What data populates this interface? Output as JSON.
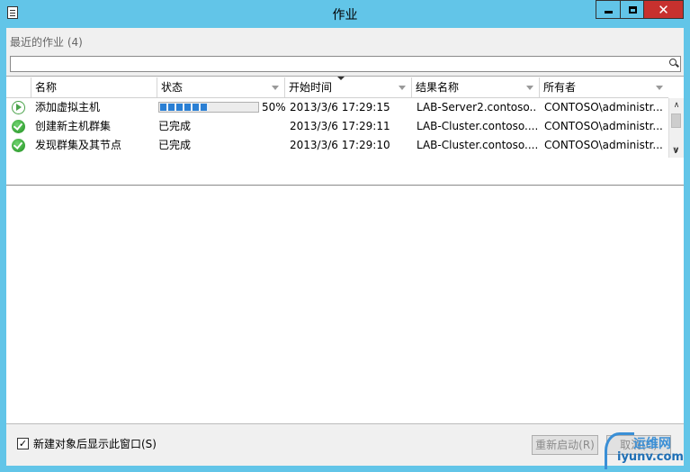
{
  "window": {
    "title": "作业",
    "close_glyph": "✕"
  },
  "recent": {
    "label": "最近的作业 (4)"
  },
  "search": {
    "placeholder": "",
    "value": ""
  },
  "grid": {
    "columns": [
      "名称",
      "状态",
      "开始时间",
      "结果名称",
      "所有者"
    ],
    "rows": [
      {
        "icon": "running-play-icon",
        "name": "添加虚拟主机",
        "progress": 0.5,
        "progress_text": "50%",
        "status": "",
        "start": "2013/3/6 17:29:15",
        "result": "LAB-Server2.contoso....",
        "owner": "CONTOSO\\administr..."
      },
      {
        "icon": "completed-check-icon",
        "name": "创建新主机群集",
        "status": "已完成",
        "start": "2013/3/6 17:29:11",
        "result": "LAB-Cluster.contoso....",
        "owner": "CONTOSO\\administr..."
      },
      {
        "icon": "completed-check-icon",
        "name": "发现群集及其节点",
        "status": "已完成",
        "start": "2013/3/6 17:29:10",
        "result": "LAB-Cluster.contoso....",
        "owner": "CONTOSO\\administr..."
      }
    ]
  },
  "footer": {
    "checkbox_checked": true,
    "checkbox_glyph": "✓",
    "checkbox_label": "新建对象后显示此窗口(S)",
    "restart_label": "重新启动(R)",
    "cancel_label": "取消(C)"
  },
  "watermark": {
    "line1": "运维网",
    "line2": "iyunv.com"
  },
  "colors": {
    "titlebar": "#62c5e8",
    "close": "#c7312e",
    "progress": "#2a7fd4",
    "success": "#1f8f1f"
  }
}
